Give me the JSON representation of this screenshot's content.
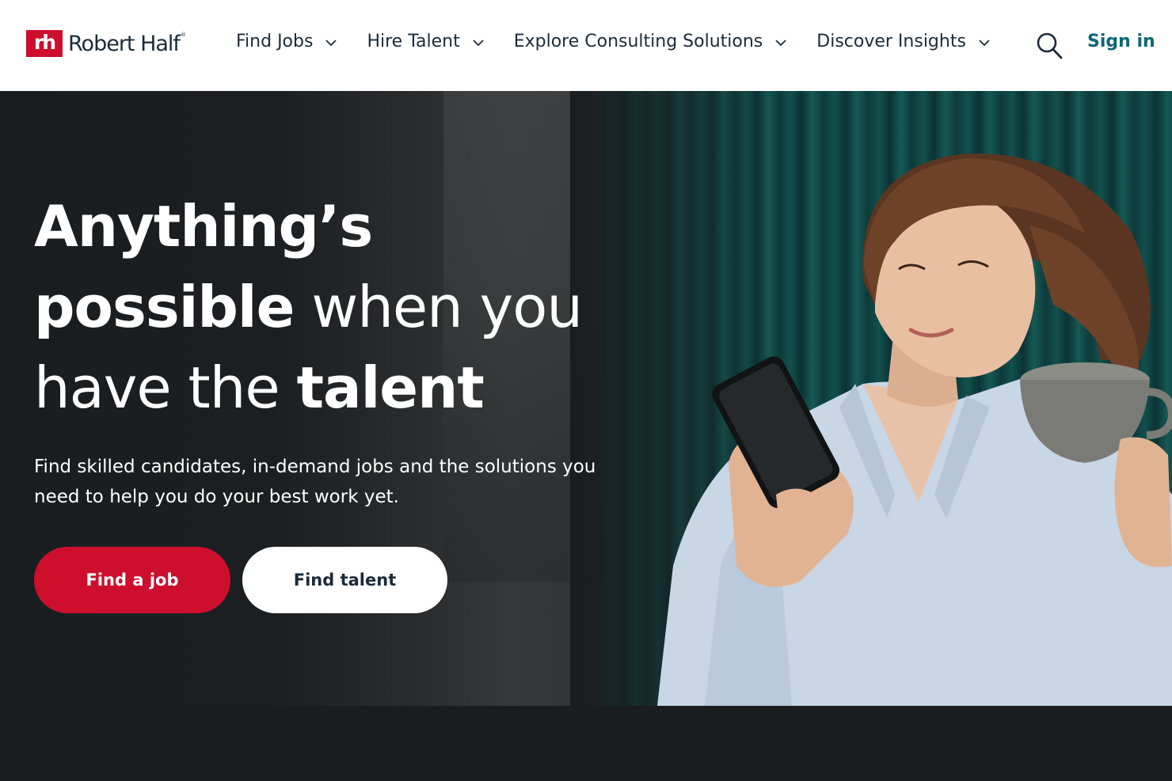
{
  "header": {
    "logo_mark": "rh",
    "logo_text": "Robert Half",
    "logo_reg": "®",
    "nav": [
      {
        "label": "Find Jobs"
      },
      {
        "label": "Hire Talent"
      },
      {
        "label": "Explore Consulting Solutions"
      },
      {
        "label": "Discover Insights"
      }
    ],
    "search_icon": "search-icon",
    "signin_label": "Sign in"
  },
  "hero": {
    "headline": {
      "line1_bold": "Anything’s",
      "line2_bold": "possible",
      "line2_light": " when you",
      "line3_light": "have the ",
      "line3_bold": "talent"
    },
    "subtext": "Find skilled candidates, in-demand jobs and the solutions you need to help you do your best work yet.",
    "primary_button": "Find a job",
    "secondary_button": "Find talent"
  },
  "colors": {
    "brand_red": "#ce0e2d",
    "teal_link": "#0d6675",
    "navy_text": "#1c2b39",
    "hero_bg": "#1a1d20"
  }
}
